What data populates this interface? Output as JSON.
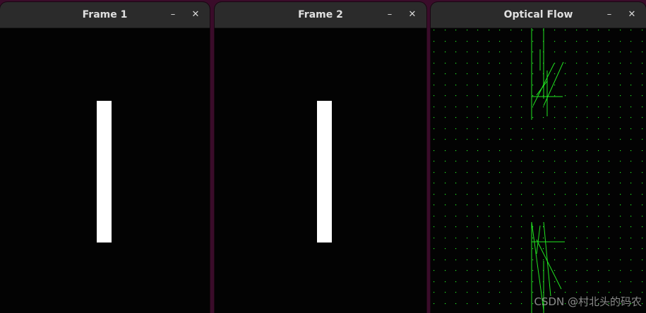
{
  "windows": {
    "frame1": {
      "title": "Frame 1",
      "minimize_glyph": "–",
      "close_glyph": "✕"
    },
    "frame2": {
      "title": "Frame 2",
      "minimize_glyph": "–",
      "close_glyph": "✕"
    },
    "flow": {
      "title": "Optical Flow",
      "minimize_glyph": "–",
      "close_glyph": "✕"
    }
  },
  "icons": {
    "minimize": "minimize-icon",
    "close": "close-icon"
  },
  "colors": {
    "desktop_background": "#3a0c2a",
    "titlebar": "#2b2b2b",
    "flow_vector": "#22e622",
    "bar": "#ffffff"
  },
  "watermark": "CSDN @村北头的码农"
}
